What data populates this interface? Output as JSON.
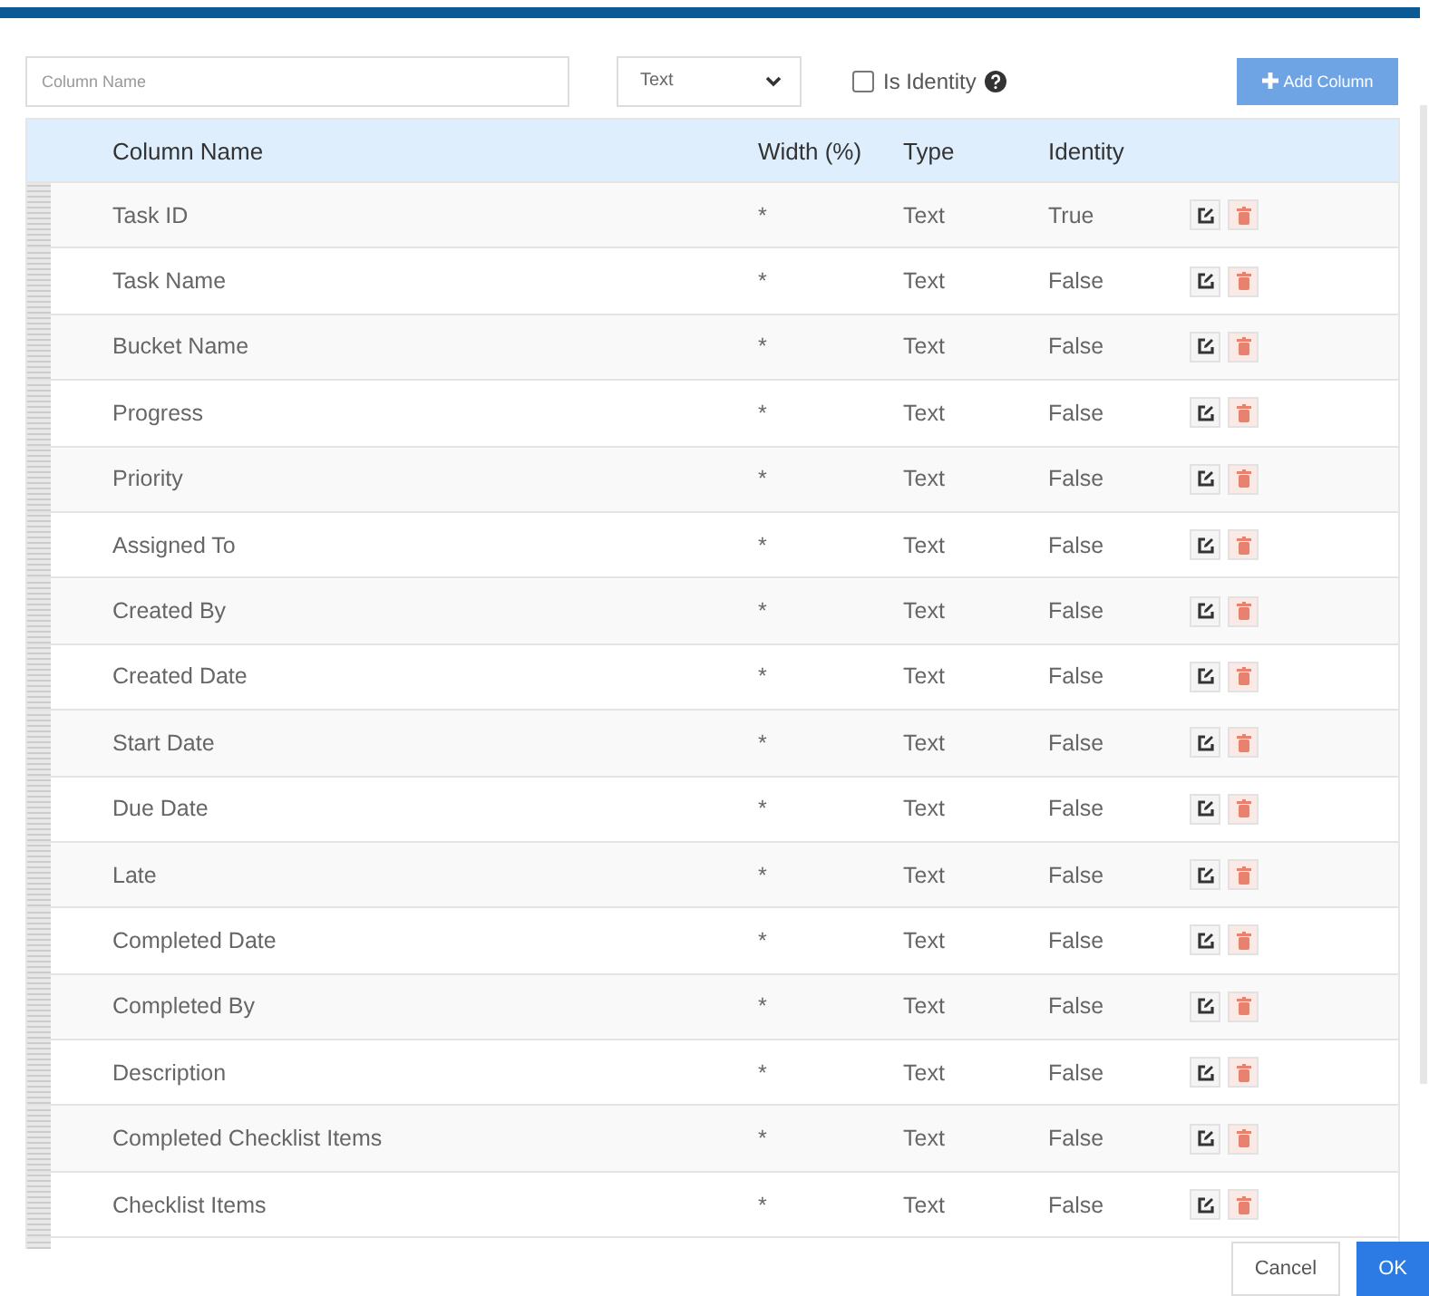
{
  "toolbar": {
    "name_field": {
      "placeholder": "Column Name"
    },
    "type_select": {
      "value": "Text"
    },
    "identity_checkbox": {
      "label": "Is Identity",
      "checked": false
    },
    "add_button": {
      "label": "Add Column"
    }
  },
  "table": {
    "columns": [
      "Column Name",
      "Width (%)",
      "Type",
      "Identity"
    ],
    "rows": [
      {
        "name": "Task ID",
        "width": "*",
        "type": "Text",
        "identity": "True"
      },
      {
        "name": "Task Name",
        "width": "*",
        "type": "Text",
        "identity": "False"
      },
      {
        "name": "Bucket Name",
        "width": "*",
        "type": "Text",
        "identity": "False"
      },
      {
        "name": "Progress",
        "width": "*",
        "type": "Text",
        "identity": "False"
      },
      {
        "name": "Priority",
        "width": "*",
        "type": "Text",
        "identity": "False"
      },
      {
        "name": "Assigned To",
        "width": "*",
        "type": "Text",
        "identity": "False"
      },
      {
        "name": "Created By",
        "width": "*",
        "type": "Text",
        "identity": "False"
      },
      {
        "name": "Created Date",
        "width": "*",
        "type": "Text",
        "identity": "False"
      },
      {
        "name": "Start Date",
        "width": "*",
        "type": "Text",
        "identity": "False"
      },
      {
        "name": "Due Date",
        "width": "*",
        "type": "Text",
        "identity": "False"
      },
      {
        "name": "Late",
        "width": "*",
        "type": "Text",
        "identity": "False"
      },
      {
        "name": "Completed Date",
        "width": "*",
        "type": "Text",
        "identity": "False"
      },
      {
        "name": "Completed By",
        "width": "*",
        "type": "Text",
        "identity": "False"
      },
      {
        "name": "Description",
        "width": "*",
        "type": "Text",
        "identity": "False"
      },
      {
        "name": "Completed Checklist Items",
        "width": "*",
        "type": "Text",
        "identity": "False"
      },
      {
        "name": "Checklist Items",
        "width": "*",
        "type": "Text",
        "identity": "False"
      }
    ]
  },
  "footer": {
    "buttons": [
      "Cancel",
      "OK"
    ]
  }
}
